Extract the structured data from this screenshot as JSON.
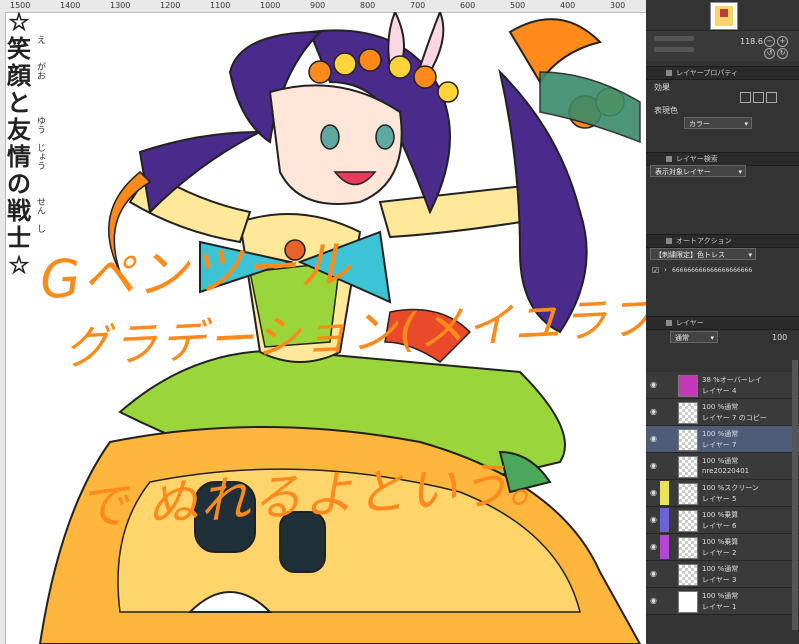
{
  "canvas": {
    "ruler_labels": [
      "1500",
      "1400",
      "1300",
      "1200",
      "1100",
      "1000",
      "900",
      "800",
      "700",
      "600",
      "500",
      "400",
      "300"
    ],
    "title_chars": [
      {
        "ch": "☆",
        "rb": ""
      },
      {
        "ch": "笑",
        "rb": "え"
      },
      {
        "ch": "顔",
        "rb": "がお"
      },
      {
        "ch": "と",
        "rb": ""
      },
      {
        "ch": "友",
        "rb": "ゆう"
      },
      {
        "ch": "情",
        "rb": "じょう"
      },
      {
        "ch": "の",
        "rb": ""
      },
      {
        "ch": "戦",
        "rb": "せん"
      },
      {
        "ch": "士",
        "rb": "し"
      },
      {
        "ch": "☆",
        "rb": ""
      }
    ],
    "handwritten": [
      "Gペンツール",
      "グラデーション(メイユラブラシ)",
      "で ぬれるよという。"
    ],
    "accent_color": "#ff8a1c"
  },
  "panel": {
    "navigator": {
      "zoom": "118.6"
    },
    "layer_property": {
      "header": "レイヤープロパティ",
      "effect_label": "効果",
      "color_label": "表現色",
      "color_value": "カラー"
    },
    "layer_search": {
      "header": "レイヤー検索",
      "dropdown": "表示対象レイヤー"
    },
    "auto_action": {
      "header": "オートアクション",
      "set_dropdown": "【刺繍限定】色トレス",
      "action_item": "666666666666666666666"
    },
    "layers": {
      "header": "レイヤー",
      "blend_mode": "通常",
      "opacity": "100",
      "rows": [
        {
          "mode": "38 %オーバーレイ",
          "name": "レイヤー 4",
          "thumb": "#c23ab8",
          "tag": "",
          "selected": false,
          "checker": false
        },
        {
          "mode": "100 %通常",
          "name": "レイヤー 7 のコピー",
          "thumb": "",
          "tag": "",
          "selected": false,
          "checker": true
        },
        {
          "mode": "100 %通常",
          "name": "レイヤー 7",
          "thumb": "",
          "tag": "",
          "selected": true,
          "checker": true
        },
        {
          "mode": "100 %通常",
          "name": "nre20220401",
          "thumb": "",
          "tag": "",
          "selected": false,
          "checker": true
        },
        {
          "mode": "100 %スクリーン",
          "name": "レイヤー 5",
          "thumb": "",
          "tag": "#e8e35a",
          "selected": false,
          "checker": true
        },
        {
          "mode": "100 %乗算",
          "name": "レイヤー 6",
          "thumb": "",
          "tag": "#6b63d8",
          "selected": false,
          "checker": true
        },
        {
          "mode": "100 %乗算",
          "name": "レイヤー 2",
          "thumb": "",
          "tag": "#b04ad0",
          "selected": false,
          "checker": true
        },
        {
          "mode": "100 %通常",
          "name": "レイヤー 3",
          "thumb": "",
          "tag": "",
          "selected": false,
          "checker": true
        },
        {
          "mode": "100 %通常",
          "name": "レイヤー 1",
          "thumb": "#ffffff",
          "tag": "",
          "selected": false,
          "checker": false
        }
      ]
    }
  }
}
